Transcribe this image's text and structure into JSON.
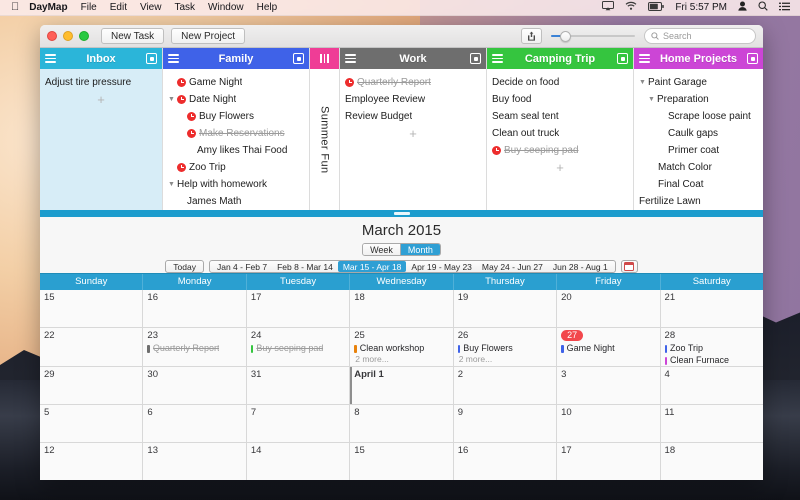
{
  "menubar": {
    "apple": "apple-logo",
    "items": [
      "DayMap",
      "File",
      "Edit",
      "View",
      "Task",
      "Window",
      "Help"
    ],
    "status": {
      "airplay": "airplay-icon",
      "wifi": "wifi-icon",
      "battery": "battery-icon",
      "clock": "Fri 5:57 PM",
      "user": "user-icon",
      "search": "spotlight-icon",
      "list": "notification-center-icon"
    }
  },
  "titlebar": {
    "new_task": "New Task",
    "new_project": "New Project",
    "share": "share-icon",
    "zoom_slider": "zoom-slider",
    "search_placeholder": "Search"
  },
  "columns": [
    {
      "name": "inbox",
      "title": "Inbox",
      "color": "#2bb5d9",
      "collapsed": false,
      "has_disclosure": true,
      "tasks": [
        {
          "label": "Adjust tire pressure",
          "indent": 0,
          "clock": false,
          "done": false,
          "arrow": "",
          "note": ""
        }
      ],
      "add": "+"
    },
    {
      "name": "family",
      "title": "Family",
      "color": "#3f62e8",
      "collapsed": false,
      "has_disclosure": true,
      "tasks": [
        {
          "label": "Game Night",
          "indent": 1,
          "clock": true,
          "done": false,
          "arrow": "",
          "note": ""
        },
        {
          "label": "Date Night",
          "indent": 0,
          "clock": true,
          "done": false,
          "arrow": "▼",
          "note": ""
        },
        {
          "label": "Buy Flowers",
          "indent": 2,
          "clock": true,
          "done": false,
          "arrow": "",
          "note": ""
        },
        {
          "label": "Make Reservations",
          "indent": 2,
          "clock": true,
          "done": true,
          "arrow": "",
          "note": "Amy likes Thai Food"
        },
        {
          "label": "Zoo Trip",
          "indent": 1,
          "clock": true,
          "done": false,
          "arrow": "",
          "note": ""
        },
        {
          "label": "Help with homework",
          "indent": 0,
          "clock": false,
          "done": false,
          "arrow": "▼",
          "note": ""
        },
        {
          "label": "James Math",
          "indent": 2,
          "clock": false,
          "done": false,
          "arrow": "",
          "note": ""
        }
      ],
      "add": ""
    },
    {
      "name": "summer-fun",
      "title": "Summer Fun",
      "color": "#ef3d96",
      "collapsed": true,
      "has_disclosure": false,
      "tasks": [],
      "add": ""
    },
    {
      "name": "work",
      "title": "Work",
      "color": "#6e6e6e",
      "collapsed": false,
      "has_disclosure": true,
      "tasks": [
        {
          "label": "Quarterly Report",
          "indent": 0,
          "clock": true,
          "done": true,
          "arrow": "",
          "note": ""
        },
        {
          "label": "Employee Review",
          "indent": 0,
          "clock": false,
          "done": false,
          "arrow": "",
          "note": ""
        },
        {
          "label": "Review Budget",
          "indent": 0,
          "clock": false,
          "done": false,
          "arrow": "",
          "note": ""
        }
      ],
      "add": "+"
    },
    {
      "name": "camping-trip",
      "title": "Camping Trip",
      "color": "#35c53f",
      "collapsed": false,
      "has_disclosure": true,
      "tasks": [
        {
          "label": "Decide on food",
          "indent": 0,
          "clock": false,
          "done": false,
          "arrow": "",
          "note": ""
        },
        {
          "label": "Buy food",
          "indent": 0,
          "clock": false,
          "done": false,
          "arrow": "",
          "note": ""
        },
        {
          "label": "Seam seal tent",
          "indent": 0,
          "clock": false,
          "done": false,
          "arrow": "",
          "note": ""
        },
        {
          "label": "Clean out truck",
          "indent": 0,
          "clock": false,
          "done": false,
          "arrow": "",
          "note": ""
        },
        {
          "label": "Buy seeping pad",
          "indent": 0,
          "clock": true,
          "done": true,
          "arrow": "",
          "note": ""
        }
      ],
      "add": "+"
    },
    {
      "name": "home-projects",
      "title": "Home Projects",
      "color": "#cc45d6",
      "collapsed": false,
      "has_disclosure": true,
      "tasks": [
        {
          "label": "Paint Garage",
          "indent": 0,
          "clock": false,
          "done": false,
          "arrow": "▼",
          "note": ""
        },
        {
          "label": "Preparation",
          "indent": 1,
          "clock": false,
          "done": false,
          "arrow": "▼",
          "note": ""
        },
        {
          "label": "Scrape loose paint",
          "indent": 3,
          "clock": false,
          "done": false,
          "arrow": "",
          "note": ""
        },
        {
          "label": "Caulk gaps",
          "indent": 3,
          "clock": false,
          "done": false,
          "arrow": "",
          "note": ""
        },
        {
          "label": "Primer coat",
          "indent": 3,
          "clock": false,
          "done": false,
          "arrow": "",
          "note": ""
        },
        {
          "label": "Match Color",
          "indent": 2,
          "clock": false,
          "done": false,
          "arrow": "",
          "note": ""
        },
        {
          "label": "Final Coat",
          "indent": 2,
          "clock": false,
          "done": false,
          "arrow": "",
          "note": ""
        },
        {
          "label": "Fertilize Lawn",
          "indent": 0,
          "clock": false,
          "done": false,
          "arrow": "",
          "note": ""
        }
      ],
      "add": ""
    }
  ],
  "calendar": {
    "title": "March 2015",
    "view_modes": [
      {
        "label": "Week",
        "selected": false
      },
      {
        "label": "Month",
        "selected": true
      }
    ],
    "today_label": "Today",
    "ranges": [
      {
        "label": "Jan 4 - Feb 7",
        "selected": false
      },
      {
        "label": "Feb 8 - Mar 14",
        "selected": false
      },
      {
        "label": "Mar 15 - Apr 18",
        "selected": true
      },
      {
        "label": "Apr 19 - May 23",
        "selected": false
      },
      {
        "label": "May 24 - Jun 27",
        "selected": false
      },
      {
        "label": "Jun 28 - Aug 1",
        "selected": false
      }
    ],
    "calendar_picker_icon": "calendar-icon",
    "weekdays": [
      "Sunday",
      "Monday",
      "Tuesday",
      "Wednesday",
      "Thursday",
      "Friday",
      "Saturday"
    ],
    "accent": "#2a9fd0",
    "today_badge_color": "#f2474c",
    "weeks": [
      [
        {
          "day": "15",
          "today": false,
          "bold": false,
          "marker": false,
          "events": [],
          "more": ""
        },
        {
          "day": "16",
          "today": false,
          "bold": false,
          "marker": false,
          "events": [],
          "more": ""
        },
        {
          "day": "17",
          "today": false,
          "bold": false,
          "marker": false,
          "events": [],
          "more": ""
        },
        {
          "day": "18",
          "today": false,
          "bold": false,
          "marker": false,
          "events": [],
          "more": ""
        },
        {
          "day": "19",
          "today": false,
          "bold": false,
          "marker": false,
          "events": [],
          "more": ""
        },
        {
          "day": "20",
          "today": false,
          "bold": false,
          "marker": false,
          "events": [],
          "more": ""
        },
        {
          "day": "21",
          "today": false,
          "bold": false,
          "marker": false,
          "events": [],
          "more": ""
        }
      ],
      [
        {
          "day": "22",
          "today": false,
          "bold": false,
          "marker": false,
          "events": [],
          "more": ""
        },
        {
          "day": "23",
          "today": false,
          "bold": false,
          "marker": false,
          "events": [
            {
              "label": "Quarterly Report",
              "color": "#6e6e6e",
              "done": true
            }
          ],
          "more": ""
        },
        {
          "day": "24",
          "today": false,
          "bold": false,
          "marker": false,
          "events": [
            {
              "label": "Buy seeping pad",
              "color": "#35c53f",
              "done": true
            }
          ],
          "more": ""
        },
        {
          "day": "25",
          "today": false,
          "bold": false,
          "marker": false,
          "events": [
            {
              "label": "Clean workshop",
              "color": "#e8820c",
              "done": false
            }
          ],
          "more": "2 more..."
        },
        {
          "day": "26",
          "today": false,
          "bold": false,
          "marker": false,
          "events": [
            {
              "label": "Buy Flowers",
              "color": "#3f62e8",
              "done": false
            }
          ],
          "more": "2 more..."
        },
        {
          "day": "27",
          "today": true,
          "bold": false,
          "marker": false,
          "events": [
            {
              "label": "Game Night",
              "color": "#3f62e8",
              "done": false
            }
          ],
          "more": ""
        },
        {
          "day": "28",
          "today": false,
          "bold": false,
          "marker": false,
          "events": [
            {
              "label": "Zoo Trip",
              "color": "#3f62e8",
              "done": false
            },
            {
              "label": "Clean Furnace",
              "color": "#cc45d6",
              "done": false
            }
          ],
          "more": ""
        }
      ],
      [
        {
          "day": "29",
          "today": false,
          "bold": false,
          "marker": false,
          "events": [],
          "more": ""
        },
        {
          "day": "30",
          "today": false,
          "bold": false,
          "marker": false,
          "events": [],
          "more": ""
        },
        {
          "day": "31",
          "today": false,
          "bold": false,
          "marker": false,
          "events": [],
          "more": ""
        },
        {
          "day": "April 1",
          "today": false,
          "bold": true,
          "marker": true,
          "events": [],
          "more": ""
        },
        {
          "day": "2",
          "today": false,
          "bold": false,
          "marker": false,
          "events": [],
          "more": ""
        },
        {
          "day": "3",
          "today": false,
          "bold": false,
          "marker": false,
          "events": [],
          "more": ""
        },
        {
          "day": "4",
          "today": false,
          "bold": false,
          "marker": false,
          "events": [],
          "more": ""
        }
      ],
      [
        {
          "day": "5",
          "today": false,
          "bold": false,
          "marker": false,
          "events": [],
          "more": ""
        },
        {
          "day": "6",
          "today": false,
          "bold": false,
          "marker": false,
          "events": [],
          "more": ""
        },
        {
          "day": "7",
          "today": false,
          "bold": false,
          "marker": false,
          "events": [],
          "more": ""
        },
        {
          "day": "8",
          "today": false,
          "bold": false,
          "marker": false,
          "events": [],
          "more": ""
        },
        {
          "day": "9",
          "today": false,
          "bold": false,
          "marker": false,
          "events": [],
          "more": ""
        },
        {
          "day": "10",
          "today": false,
          "bold": false,
          "marker": false,
          "events": [],
          "more": ""
        },
        {
          "day": "11",
          "today": false,
          "bold": false,
          "marker": false,
          "events": [],
          "more": ""
        }
      ],
      [
        {
          "day": "12",
          "today": false,
          "bold": false,
          "marker": false,
          "events": [],
          "more": ""
        },
        {
          "day": "13",
          "today": false,
          "bold": false,
          "marker": false,
          "events": [],
          "more": ""
        },
        {
          "day": "14",
          "today": false,
          "bold": false,
          "marker": false,
          "events": [],
          "more": ""
        },
        {
          "day": "15",
          "today": false,
          "bold": false,
          "marker": false,
          "events": [],
          "more": ""
        },
        {
          "day": "16",
          "today": false,
          "bold": false,
          "marker": false,
          "events": [],
          "more": ""
        },
        {
          "day": "17",
          "today": false,
          "bold": false,
          "marker": false,
          "events": [],
          "more": ""
        },
        {
          "day": "18",
          "today": false,
          "bold": false,
          "marker": false,
          "events": [],
          "more": ""
        }
      ]
    ]
  }
}
